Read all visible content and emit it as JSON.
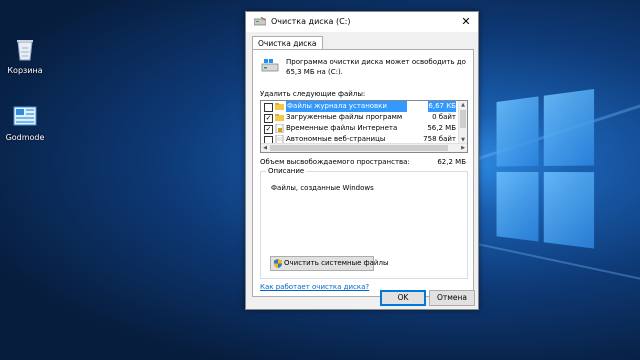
{
  "dialog": {
    "title": "Очистка диска  (C:)",
    "close_glyph": "✕",
    "tab_label": "Очистка диска",
    "intro": "Программа очистки диска может освободить до 65,3 МБ на  (C:).",
    "list_label": "Удалить следующие файлы:",
    "files": [
      {
        "name": "Файлы журнала установки",
        "size": "6,67 КБ",
        "checked": false,
        "selected": true,
        "icon": "folder-icon"
      },
      {
        "name": "Загруженные файлы программ",
        "size": "0 байт",
        "checked": true,
        "selected": false,
        "icon": "folder-icon"
      },
      {
        "name": "Временные файлы Интернета",
        "size": "56,2 МБ",
        "checked": true,
        "selected": false,
        "icon": "lock-file-icon"
      },
      {
        "name": "Автономные веб-страницы",
        "size": "758 байт",
        "checked": false,
        "selected": false,
        "icon": "page-icon"
      }
    ],
    "gained_label": "Объем высвобождаемого пространства:",
    "gained_value": "62,2 МБ",
    "description_legend": "Описание",
    "description_text": "Файлы, созданные Windows",
    "system_button": "Очистить системные файлы",
    "help_link": "Как работает очистка диска?",
    "ok_label": "OK",
    "cancel_label": "Отмена"
  },
  "desktop_icons": [
    {
      "label": "Корзина",
      "icon": "recycle-bin-icon"
    },
    {
      "label": "Godmode",
      "icon": "control-panel-icon"
    }
  ],
  "colors": {
    "selection": "#3399ff",
    "link": "#0066cc",
    "desktop": "#0e3a77"
  }
}
